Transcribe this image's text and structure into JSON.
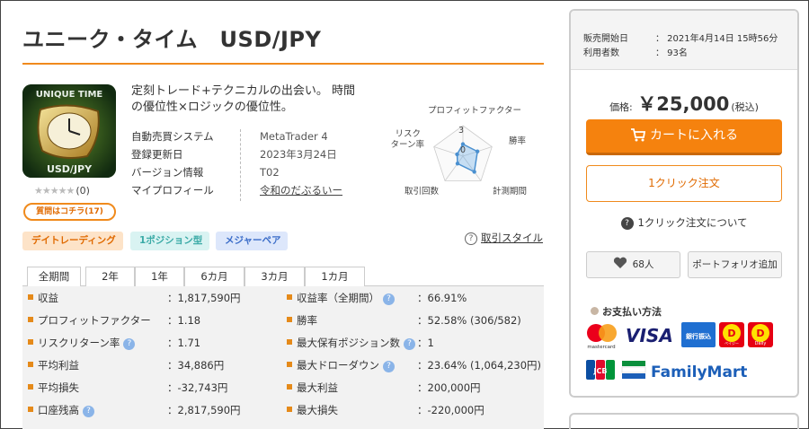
{
  "product": {
    "title": "ユニーク・タイム　USD/JPY",
    "image_text_top": "UNIQUE TIME",
    "image_text_bottom": "USD/JPY",
    "stars": "★★★★★",
    "review_count": "(0)",
    "qa_button": "質問はコチラ(17)",
    "tagline": "定刻トレード+テクニカルの出会い。 時間の優位性×ロジックの優位性。"
  },
  "info": [
    {
      "label": "自動売買システム",
      "value": "MetaTrader 4"
    },
    {
      "label": "登録更新日",
      "value": "2023年3月24日"
    },
    {
      "label": "バージョン情報",
      "value": "T02"
    },
    {
      "label": "マイプロフィール",
      "value": "令和のだぶるいー"
    }
  ],
  "radar": {
    "labels": [
      "プロフィットファクター",
      "勝率",
      "計測期間",
      "取引回数",
      "リスク\nターン率"
    ],
    "scale_max": "3",
    "scale_zero": "0",
    "values": [
      1.18,
      1.5,
      1.9,
      0.9,
      0.6
    ]
  },
  "tags": [
    "デイトレーディング",
    "1ポジション型",
    "メジャーペア"
  ],
  "trade_style_link": "取引スタイル",
  "period_tabs": [
    "全期間",
    "2年",
    "1年",
    "6カ月",
    "3カ月",
    "1カ月"
  ],
  "stats_left": [
    {
      "label": "収益",
      "value": "：1,817,590円",
      "help": false
    },
    {
      "label": "プロフィットファクター",
      "value": "：1.18",
      "help": false
    },
    {
      "label": "リスクリターン率",
      "value": "：1.71",
      "help": true
    },
    {
      "label": "平均利益",
      "value": "：34,886円",
      "help": false
    },
    {
      "label": "平均損失",
      "value": "：-32,743円",
      "help": false
    },
    {
      "label": "口座残高",
      "value": "：2,817,590円",
      "help": true
    }
  ],
  "stats_right": [
    {
      "label": "収益率（全期間）",
      "value": "：66.91%",
      "help": true
    },
    {
      "label": "勝率",
      "value": "：52.58% (306/582)",
      "help": false
    },
    {
      "label": "最大保有ポジション数",
      "value": "：1",
      "help": true
    },
    {
      "label": "最大ドローダウン",
      "value": "：23.64% (1,064,230円)",
      "help": true
    },
    {
      "label": "最大利益",
      "value": "：200,000円",
      "help": false
    },
    {
      "label": "最大損失",
      "value": "：-220,000円",
      "help": false
    }
  ],
  "sidebar": {
    "sale_start_label": "販売開始日",
    "sale_start_value": "：  2021年4月14日 15時56分",
    "users_label": "利用者数",
    "users_value": "：  93名",
    "price_label": "価格:",
    "price_value": "￥25,000",
    "price_tax": "(税込)",
    "cart_button": "カートに入れる",
    "oneclick_button": "1クリック注文",
    "about_oneclick": "1クリック注文について",
    "fav_count": "68人",
    "portfolio_button": "ポートフォリオ追加",
    "payment_title": "お支払い方法",
    "pay_mastercard": "mastercard",
    "pay_visa": "VISA",
    "pay_bank": "銀行振込",
    "pay_pay": "ペイジー",
    "pay_daily": "Daily",
    "pay_jcb": "JCB",
    "pay_familymart": "FamilyMart"
  }
}
